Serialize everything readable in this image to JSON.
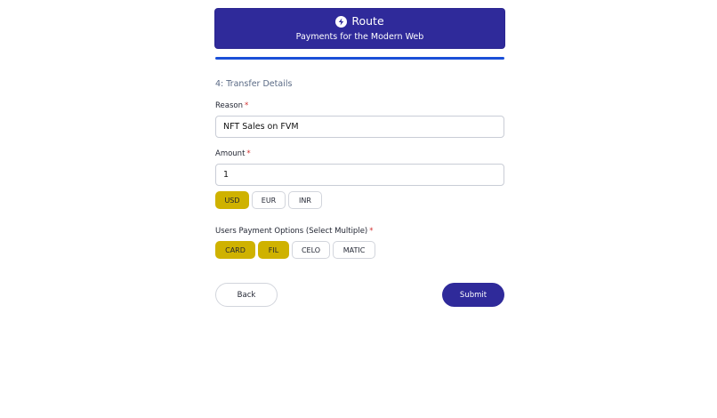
{
  "brand": {
    "name": "Route",
    "tagline": "Payments for the Modern Web",
    "icon": "lightning-circle-icon",
    "color": "#2f2a9a"
  },
  "progress": {
    "fraction": 1.0,
    "color": "#1a4fd8"
  },
  "step": {
    "title": "4: Transfer Details"
  },
  "form": {
    "reason": {
      "label": "Reason",
      "required_mark": "*",
      "value": "NFT Sales on FVM"
    },
    "amount": {
      "label": "Amount",
      "required_mark": "*",
      "value": "1"
    },
    "currencies": [
      {
        "label": "USD",
        "selected": true
      },
      {
        "label": "EUR",
        "selected": false
      },
      {
        "label": "INR",
        "selected": false
      }
    ],
    "payment_options": {
      "label": "Users Payment Options (Select Multiple)",
      "required_mark": "*",
      "options": [
        {
          "label": "CARD",
          "selected": true
        },
        {
          "label": "FIL",
          "selected": true
        },
        {
          "label": "CELO",
          "selected": false
        },
        {
          "label": "MATIC",
          "selected": false
        }
      ]
    }
  },
  "actions": {
    "back_label": "Back",
    "submit_label": "Submit"
  },
  "colors": {
    "selected_chip": "#cfb200",
    "required": "#d23030"
  }
}
